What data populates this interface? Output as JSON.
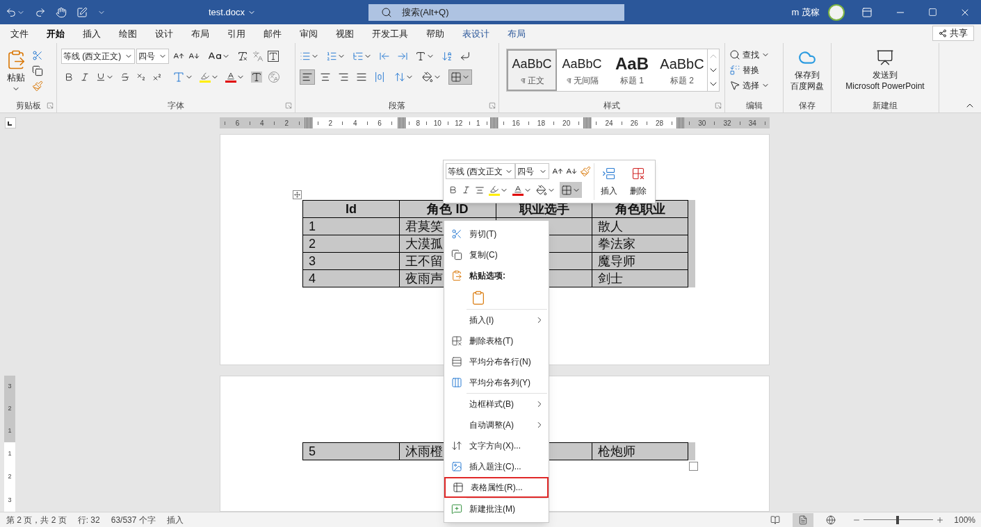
{
  "title_bar": {
    "file_name": "test.docx",
    "search_placeholder": "搜索(Alt+Q)",
    "user_name": "m 茂稼"
  },
  "tabs": [
    {
      "label": "文件",
      "selected": false,
      "kind": "normal"
    },
    {
      "label": "开始",
      "selected": true,
      "kind": "normal"
    },
    {
      "label": "插入",
      "selected": false,
      "kind": "normal"
    },
    {
      "label": "绘图",
      "selected": false,
      "kind": "normal"
    },
    {
      "label": "设计",
      "selected": false,
      "kind": "normal"
    },
    {
      "label": "布局",
      "selected": false,
      "kind": "normal"
    },
    {
      "label": "引用",
      "selected": false,
      "kind": "normal"
    },
    {
      "label": "邮件",
      "selected": false,
      "kind": "normal"
    },
    {
      "label": "审阅",
      "selected": false,
      "kind": "normal"
    },
    {
      "label": "视图",
      "selected": false,
      "kind": "normal"
    },
    {
      "label": "开发工具",
      "selected": false,
      "kind": "normal"
    },
    {
      "label": "帮助",
      "selected": false,
      "kind": "normal"
    },
    {
      "label": "表设计",
      "selected": false,
      "kind": "contextual"
    },
    {
      "label": "布局",
      "selected": false,
      "kind": "contextual"
    }
  ],
  "share_button": "共享",
  "ribbon": {
    "clipboard": {
      "label": "剪贴板",
      "paste": "粘贴"
    },
    "font": {
      "label": "字体",
      "font_name": "等线 (西文正文)",
      "font_size": "四号"
    },
    "paragraph": {
      "label": "段落",
      "alignments": [
        {
          "kind": "left",
          "selected": true
        },
        {
          "kind": "center",
          "selected": false
        },
        {
          "kind": "right",
          "selected": false
        },
        {
          "kind": "justify",
          "selected": false
        },
        {
          "kind": "distributed",
          "selected": false
        }
      ],
      "borders_selected": true
    },
    "styles": {
      "label": "样式",
      "items": [
        {
          "preview": "AaBbC",
          "name": "正文",
          "selected": true,
          "kind": "paragraph"
        },
        {
          "preview": "AaBbC",
          "name": "无间隔",
          "selected": false,
          "kind": "paragraph"
        },
        {
          "preview": "AaB",
          "name": "标题 1",
          "selected": false,
          "kind": "heading_1"
        },
        {
          "preview": "AaBbC",
          "name": "标题 2",
          "selected": false,
          "kind": "heading_2"
        }
      ]
    },
    "editing": {
      "label": "编辑",
      "find": "查找",
      "replace": "替换",
      "select": "选择"
    },
    "save": {
      "label": "保存",
      "button_lines": [
        "保存到",
        "百度网盘"
      ]
    },
    "new_group": {
      "label": "新建组",
      "button_lines": [
        "发送到",
        "Microsoft PowerPoint"
      ]
    }
  },
  "ruler": {
    "segments": [
      {
        "labels": [
          "6",
          "4",
          "2"
        ],
        "margin": true
      },
      {
        "labels": [
          "2",
          "4",
          "6"
        ],
        "margin": false
      },
      {
        "labels": [
          "8",
          "10",
          "12",
          "1"
        ],
        "margin": false
      },
      {
        "labels": [
          "16",
          "18",
          "20"
        ],
        "margin": false
      },
      {
        "labels": [
          "24",
          "26",
          "28"
        ],
        "margin": false
      },
      {
        "labels": [
          "30",
          "32",
          "34"
        ],
        "margin": true
      }
    ]
  },
  "vertical_ruler": {
    "segments": [
      {
        "labels": [
          "3",
          "2",
          "1"
        ],
        "margin": true
      },
      {
        "labels": [
          "1",
          "2",
          "3"
        ],
        "margin": false
      }
    ]
  },
  "page_1_table": {
    "header": [
      "Id",
      "角色 ID",
      "职业选手",
      "角色职业"
    ],
    "rows": [
      {
        "id": "1",
        "role_id": "君莫笑",
        "role_class": "散人"
      },
      {
        "id": "2",
        "role_id": "大漠孤",
        "role_class": "拳法家"
      },
      {
        "id": "3",
        "role_id": "王不留",
        "role_class": "魔导师"
      },
      {
        "id": "4",
        "role_id": "夜雨声",
        "role_class": "剑士"
      }
    ]
  },
  "page_2_table": {
    "rows": [
      {
        "id": "5",
        "role_id": "沐雨橙",
        "role_class": "枪炮师"
      }
    ]
  },
  "mini_toolbar": {
    "font_name": "等线 (西文正文",
    "font_size": "四号",
    "insert": "插入",
    "delete": "删除",
    "borders_selected": true
  },
  "context_menu": [
    {
      "kind": "item",
      "label": "剪切(T)",
      "submenu": false,
      "highlighted": false
    },
    {
      "kind": "item",
      "label": "复制(C)",
      "submenu": false,
      "highlighted": false
    },
    {
      "kind": "paste_header",
      "label": "粘贴选项:"
    },
    {
      "kind": "paste_option"
    },
    {
      "kind": "separator"
    },
    {
      "kind": "item",
      "label": "插入(I)",
      "submenu": true,
      "highlighted": false
    },
    {
      "kind": "item",
      "label": "删除表格(T)",
      "submenu": false,
      "highlighted": false
    },
    {
      "kind": "item",
      "label": "平均分布各行(N)",
      "submenu": false,
      "highlighted": false
    },
    {
      "kind": "item",
      "label": "平均分布各列(Y)",
      "submenu": false,
      "highlighted": false
    },
    {
      "kind": "separator"
    },
    {
      "kind": "item",
      "label": "边框样式(B)",
      "submenu": true,
      "highlighted": false
    },
    {
      "kind": "item",
      "label": "自动调整(A)",
      "submenu": true,
      "highlighted": false
    },
    {
      "kind": "item",
      "label": "文字方向(X)...",
      "submenu": false,
      "highlighted": false
    },
    {
      "kind": "item",
      "label": "插入题注(C)...",
      "submenu": false,
      "highlighted": false
    },
    {
      "kind": "item",
      "label": "表格属性(R)...",
      "submenu": false,
      "highlighted": true
    },
    {
      "kind": "separator"
    },
    {
      "kind": "item",
      "label": "新建批注(M)",
      "submenu": false,
      "highlighted": false
    }
  ],
  "status_bar": {
    "page": "第 2 页，共 2 页",
    "line": "行: 32",
    "word_count": "63/537 个字",
    "mode": "插入",
    "views": [
      {
        "kind": "read",
        "selected": false
      },
      {
        "kind": "print",
        "selected": true
      },
      {
        "kind": "web",
        "selected": false
      }
    ],
    "zoom": {
      "level": 0.47,
      "reading": "100%"
    }
  }
}
